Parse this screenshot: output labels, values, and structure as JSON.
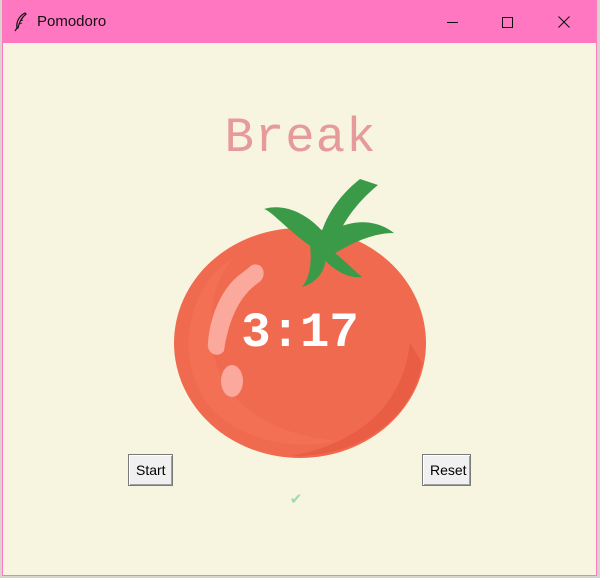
{
  "window": {
    "title": "Pomodoro",
    "app_icon": "feather-icon",
    "controls": [
      "minimize-icon",
      "maximize-icon",
      "close-icon"
    ],
    "titlebar_color": "#ff77c1",
    "background_color": "#f7f5df"
  },
  "main": {
    "heading": "Break",
    "heading_color": "#e79a9a",
    "timer": "3:17",
    "tomato_icon": "tomato-icon",
    "start_label": "Start",
    "reset_label": "Reset",
    "checkmarks": "✔",
    "checkmark_color": "#9bdeac"
  }
}
